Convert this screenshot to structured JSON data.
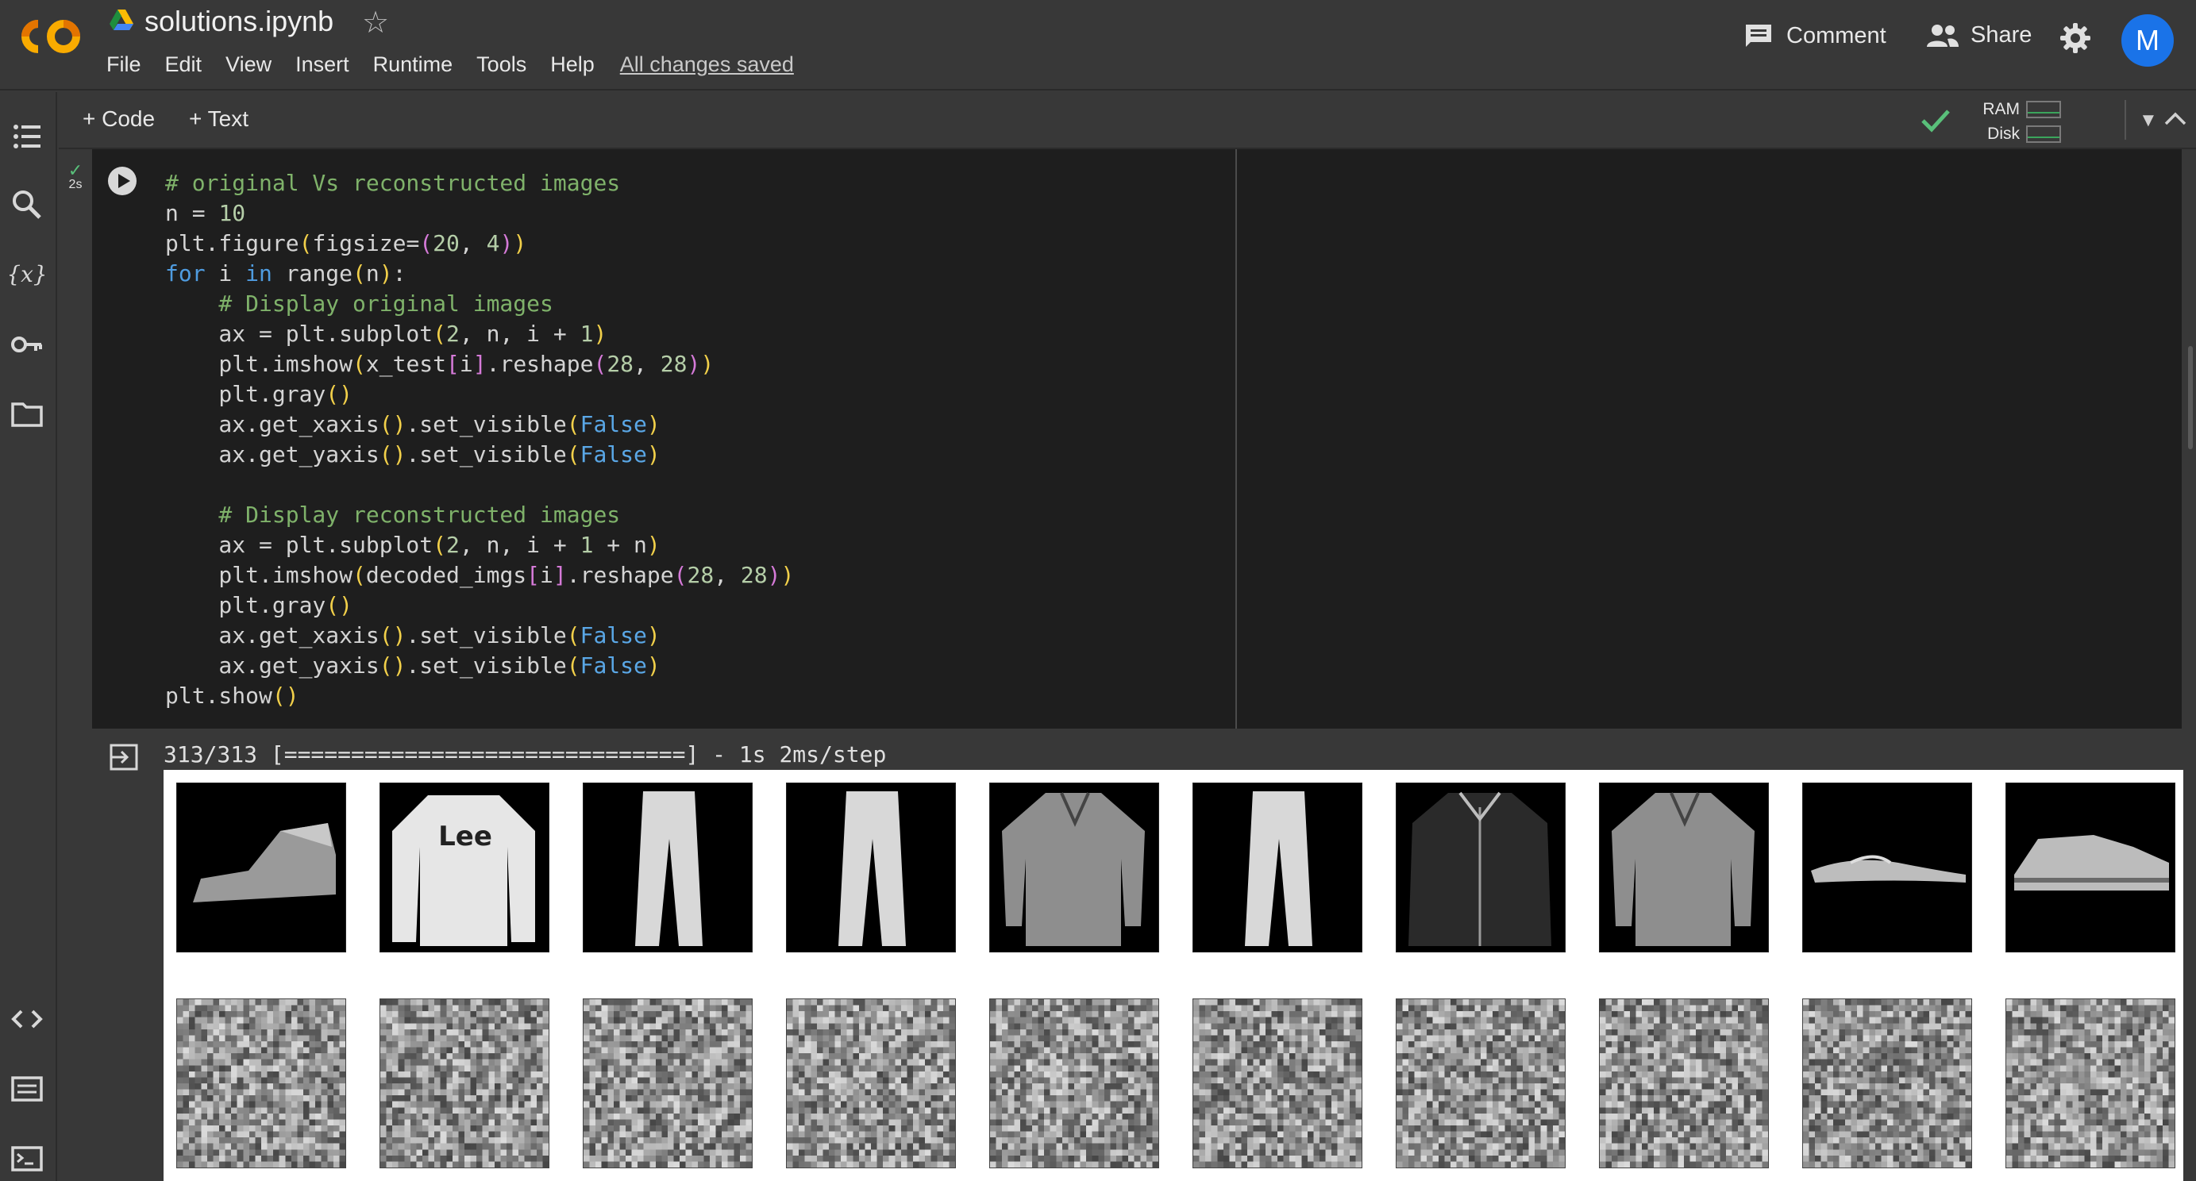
{
  "app": {
    "notebook_title": "solutions.ipynb",
    "menu": [
      "File",
      "Edit",
      "View",
      "Insert",
      "Runtime",
      "Tools",
      "Help"
    ],
    "save_status": "All changes saved",
    "comment_label": "Comment",
    "share_label": "Share",
    "avatar_initial": "M"
  },
  "toolbar": {
    "add_code_label": "+ Code",
    "add_text_label": "+ Text",
    "ram_label": "RAM",
    "disk_label": "Disk"
  },
  "cell": {
    "exec_time": "2s",
    "code_lines": [
      "# original Vs reconstructed images",
      "n = 10",
      "plt.figure(figsize=(20, 4))",
      "for i in range(n):",
      "    # Display original images",
      "    ax = plt.subplot(2, n, i + 1)",
      "    plt.imshow(x_test[i].reshape(28, 28))",
      "    plt.gray()",
      "    ax.get_xaxis().set_visible(False)",
      "    ax.get_yaxis().set_visible(False)",
      "",
      "    # Display reconstructed images",
      "    ax = plt.subplot(2, n, i + 1 + n)",
      "    plt.imshow(decoded_imgs[i].reshape(28, 28))",
      "    plt.gray()",
      "    ax.get_xaxis().set_visible(False)",
      "    ax.get_yaxis().set_visible(False)",
      "plt.show()"
    ],
    "output_text": "313/313 [==============================] - 1s 2ms/step"
  },
  "figure": {
    "originals": [
      "ankle-boot",
      "pullover",
      "trouser",
      "trouser",
      "shirt",
      "trouser",
      "coat",
      "shirt",
      "sandal",
      "sneaker"
    ],
    "reconstructed": [
      "noise",
      "noise",
      "noise",
      "noise",
      "noise",
      "noise",
      "noise",
      "noise",
      "noise",
      "noise"
    ]
  },
  "icons": {
    "logo": "colab-logo",
    "drive": "google-drive-icon",
    "star": "star-icon",
    "comment": "comment-icon",
    "share": "share-people-icon",
    "settings": "gear-icon",
    "rail": [
      "table-of-contents-icon",
      "search-icon",
      "variables-icon",
      "key-icon",
      "folder-icon",
      "code-snippets-icon",
      "command-palette-icon",
      "terminal-icon"
    ]
  },
  "colors": {
    "background": "#383838",
    "code_background": "#1e1e1e",
    "logo_orange": "#f9ab00",
    "avatar_blue": "#1a73e8",
    "success_green": "#59c07a"
  }
}
